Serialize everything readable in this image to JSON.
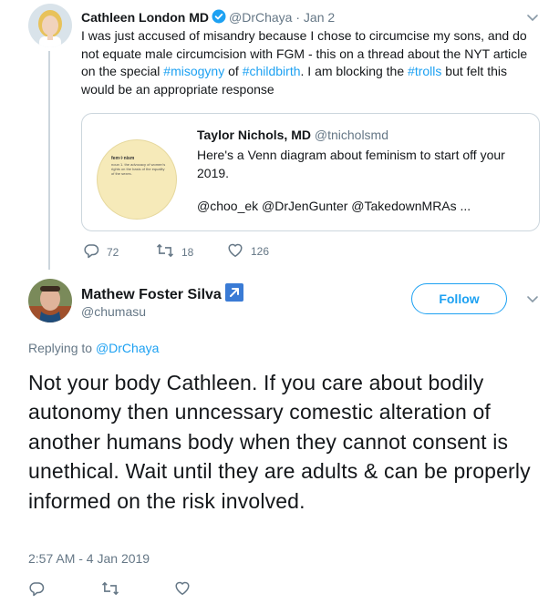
{
  "parent_tweet": {
    "author_name": "Cathleen London MD",
    "handle": "@DrChaya",
    "separator": "·",
    "time": "Jan 2",
    "text_parts": [
      {
        "text": "I was just accused of misandry because I chose to circumcise my sons, and do not equate male circumcision with FGM - this on a thread about the NYT article on the special ",
        "link": false
      },
      {
        "text": "#misogyny",
        "link": true
      },
      {
        "text": " of ",
        "link": false
      },
      {
        "text": "#childbirth",
        "link": true
      },
      {
        "text": ". I am blocking the ",
        "link": false
      },
      {
        "text": "#trolls",
        "link": true
      },
      {
        "text": " but felt this would be an appropriate response",
        "link": false
      }
    ],
    "quoted": {
      "author_name": "Taylor Nichols, MD",
      "handle": "@tnicholsmd",
      "text": "Here's a Venn diagram about feminism to start off your 2019.",
      "mentions": "@choo_ek @DrJenGunter @TakedownMRAs ...",
      "image_title": "fem·i·nism",
      "image_text": "noun 1. the advocacy of women's rights on the basis of the equality of the sexes."
    },
    "stats": {
      "replies": "72",
      "retweets": "18",
      "likes": "126"
    }
  },
  "main_tweet": {
    "author_name": "Mathew Foster Silva",
    "handle": "@chumasu",
    "follow_label": "Follow",
    "replying_prefix": "Replying to",
    "replying_to": "@DrChaya",
    "text": "Not your body Cathleen. If you care about bodily autonomy then unncessary comestic alteration of another humans body when they cannot consent is unethical. Wait until they are adults & can be properly informed on the risk involved.",
    "timestamp": "2:57 AM - 4 Jan 2019"
  },
  "icons": {
    "verified": "verified-badge-icon",
    "caret": "chevron-down-icon",
    "reply": "reply-icon",
    "retweet": "retweet-icon",
    "like": "heart-icon",
    "external": "arrow-up-right-icon"
  },
  "colors": {
    "accent": "#1da1f2",
    "text": "#14171a",
    "secondary": "#657786",
    "border": "#ccd6dd"
  }
}
